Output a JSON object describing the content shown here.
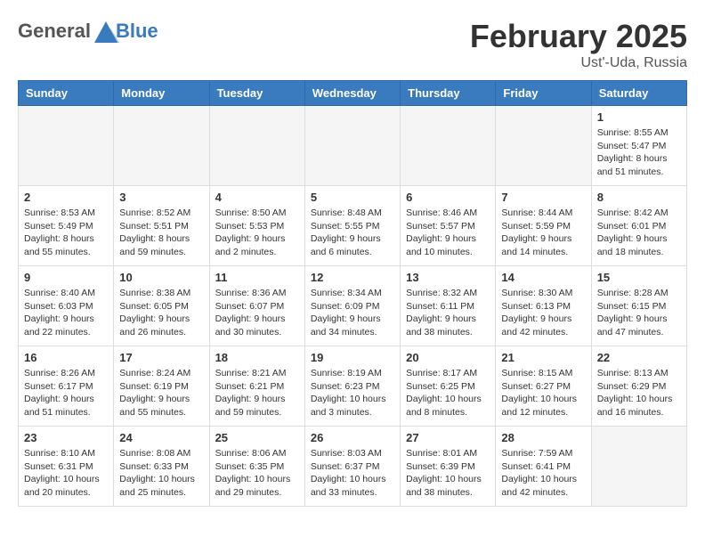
{
  "header": {
    "logo_general": "General",
    "logo_blue": "Blue",
    "month_title": "February 2025",
    "location": "Ust'-Uda, Russia"
  },
  "days_of_week": [
    "Sunday",
    "Monday",
    "Tuesday",
    "Wednesday",
    "Thursday",
    "Friday",
    "Saturday"
  ],
  "weeks": [
    [
      {
        "day": "",
        "info": ""
      },
      {
        "day": "",
        "info": ""
      },
      {
        "day": "",
        "info": ""
      },
      {
        "day": "",
        "info": ""
      },
      {
        "day": "",
        "info": ""
      },
      {
        "day": "",
        "info": ""
      },
      {
        "day": "1",
        "info": "Sunrise: 8:55 AM\nSunset: 5:47 PM\nDaylight: 8 hours and 51 minutes."
      }
    ],
    [
      {
        "day": "2",
        "info": "Sunrise: 8:53 AM\nSunset: 5:49 PM\nDaylight: 8 hours and 55 minutes."
      },
      {
        "day": "3",
        "info": "Sunrise: 8:52 AM\nSunset: 5:51 PM\nDaylight: 8 hours and 59 minutes."
      },
      {
        "day": "4",
        "info": "Sunrise: 8:50 AM\nSunset: 5:53 PM\nDaylight: 9 hours and 2 minutes."
      },
      {
        "day": "5",
        "info": "Sunrise: 8:48 AM\nSunset: 5:55 PM\nDaylight: 9 hours and 6 minutes."
      },
      {
        "day": "6",
        "info": "Sunrise: 8:46 AM\nSunset: 5:57 PM\nDaylight: 9 hours and 10 minutes."
      },
      {
        "day": "7",
        "info": "Sunrise: 8:44 AM\nSunset: 5:59 PM\nDaylight: 9 hours and 14 minutes."
      },
      {
        "day": "8",
        "info": "Sunrise: 8:42 AM\nSunset: 6:01 PM\nDaylight: 9 hours and 18 minutes."
      }
    ],
    [
      {
        "day": "9",
        "info": "Sunrise: 8:40 AM\nSunset: 6:03 PM\nDaylight: 9 hours and 22 minutes."
      },
      {
        "day": "10",
        "info": "Sunrise: 8:38 AM\nSunset: 6:05 PM\nDaylight: 9 hours and 26 minutes."
      },
      {
        "day": "11",
        "info": "Sunrise: 8:36 AM\nSunset: 6:07 PM\nDaylight: 9 hours and 30 minutes."
      },
      {
        "day": "12",
        "info": "Sunrise: 8:34 AM\nSunset: 6:09 PM\nDaylight: 9 hours and 34 minutes."
      },
      {
        "day": "13",
        "info": "Sunrise: 8:32 AM\nSunset: 6:11 PM\nDaylight: 9 hours and 38 minutes."
      },
      {
        "day": "14",
        "info": "Sunrise: 8:30 AM\nSunset: 6:13 PM\nDaylight: 9 hours and 42 minutes."
      },
      {
        "day": "15",
        "info": "Sunrise: 8:28 AM\nSunset: 6:15 PM\nDaylight: 9 hours and 47 minutes."
      }
    ],
    [
      {
        "day": "16",
        "info": "Sunrise: 8:26 AM\nSunset: 6:17 PM\nDaylight: 9 hours and 51 minutes."
      },
      {
        "day": "17",
        "info": "Sunrise: 8:24 AM\nSunset: 6:19 PM\nDaylight: 9 hours and 55 minutes."
      },
      {
        "day": "18",
        "info": "Sunrise: 8:21 AM\nSunset: 6:21 PM\nDaylight: 9 hours and 59 minutes."
      },
      {
        "day": "19",
        "info": "Sunrise: 8:19 AM\nSunset: 6:23 PM\nDaylight: 10 hours and 3 minutes."
      },
      {
        "day": "20",
        "info": "Sunrise: 8:17 AM\nSunset: 6:25 PM\nDaylight: 10 hours and 8 minutes."
      },
      {
        "day": "21",
        "info": "Sunrise: 8:15 AM\nSunset: 6:27 PM\nDaylight: 10 hours and 12 minutes."
      },
      {
        "day": "22",
        "info": "Sunrise: 8:13 AM\nSunset: 6:29 PM\nDaylight: 10 hours and 16 minutes."
      }
    ],
    [
      {
        "day": "23",
        "info": "Sunrise: 8:10 AM\nSunset: 6:31 PM\nDaylight: 10 hours and 20 minutes."
      },
      {
        "day": "24",
        "info": "Sunrise: 8:08 AM\nSunset: 6:33 PM\nDaylight: 10 hours and 25 minutes."
      },
      {
        "day": "25",
        "info": "Sunrise: 8:06 AM\nSunset: 6:35 PM\nDaylight: 10 hours and 29 minutes."
      },
      {
        "day": "26",
        "info": "Sunrise: 8:03 AM\nSunset: 6:37 PM\nDaylight: 10 hours and 33 minutes."
      },
      {
        "day": "27",
        "info": "Sunrise: 8:01 AM\nSunset: 6:39 PM\nDaylight: 10 hours and 38 minutes."
      },
      {
        "day": "28",
        "info": "Sunrise: 7:59 AM\nSunset: 6:41 PM\nDaylight: 10 hours and 42 minutes."
      },
      {
        "day": "",
        "info": ""
      }
    ]
  ]
}
